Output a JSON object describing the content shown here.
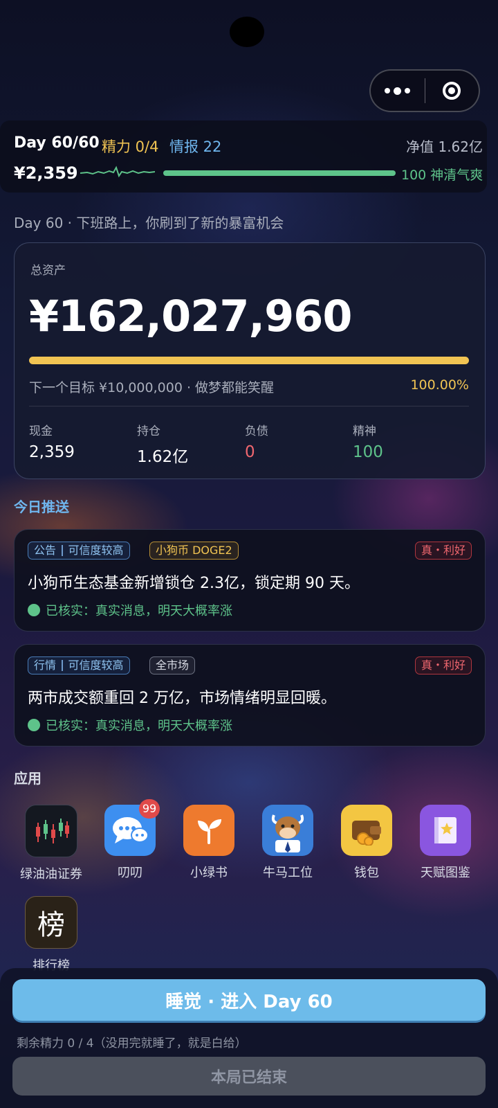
{
  "header": {
    "day": "Day 60/60",
    "energy": "精力 0/4",
    "intel": "情报 22",
    "net_worth": "净值 1.62亿",
    "cash": "¥2,359",
    "health_text": "100 神清气爽",
    "health_level": 1.0
  },
  "event_line": "Day 60 · 下班路上，你刷到了新的暴富机会",
  "assets": {
    "label": "总资产",
    "value": "¥162,027,960",
    "goal_text": "下一个目标 ¥10,000,000 · 做梦都能笑醒",
    "goal_pct": "100.00%",
    "goal_progress": 1.0,
    "stats": [
      {
        "label": "现金",
        "value": "2,359",
        "color": "#ffffff"
      },
      {
        "label": "持仓",
        "value": "1.62亿",
        "color": "#ffffff"
      },
      {
        "label": "负债",
        "value": "0",
        "color": "#f0676f"
      },
      {
        "label": "精神",
        "value": "100",
        "color": "#5ec38a"
      }
    ]
  },
  "feed": {
    "title": "今日推送",
    "items": [
      {
        "type": "公告",
        "credibility": "可信度较高",
        "scope": "小狗币 DOGE2",
        "verdict": "真・利好",
        "text": "小狗币生态基金新增锁仓 2.3亿，锁定期 90 天。",
        "verify": "已核实：真实消息，明天大概率涨"
      },
      {
        "type": "行情",
        "credibility": "可信度较高",
        "scope": "全市场",
        "verdict": "真・利好",
        "text": "两市成交额重回 2 万亿，市场情绪明显回暖。",
        "verify": "已核实：真实消息，明天大概率涨"
      }
    ]
  },
  "apps": {
    "title": "应用",
    "items": [
      {
        "name": "绿油油证券",
        "icon": "candlestick-chart-icon"
      },
      {
        "name": "叨叨",
        "icon": "chat-bubbles-icon",
        "badge": "99"
      },
      {
        "name": "小绿书",
        "icon": "sprout-icon"
      },
      {
        "name": "牛马工位",
        "icon": "cow-avatar-icon"
      },
      {
        "name": "钱包",
        "icon": "wallet-icon"
      },
      {
        "name": "天赋图鉴",
        "icon": "star-book-icon"
      },
      {
        "name": "排行榜",
        "icon": "leaderboard-glyph-icon",
        "glyph": "榜"
      }
    ]
  },
  "footer": {
    "sleep_label": "睡觉 · 进入 Day 60",
    "hint": "剩余精力 0 / 4（没用完就睡了，就是白给）",
    "end_label": "本局已结束"
  },
  "colors": {
    "gold": "#f1c453",
    "green": "#5ec38a",
    "blue": "#6fb6ee",
    "red": "#f0676f"
  }
}
